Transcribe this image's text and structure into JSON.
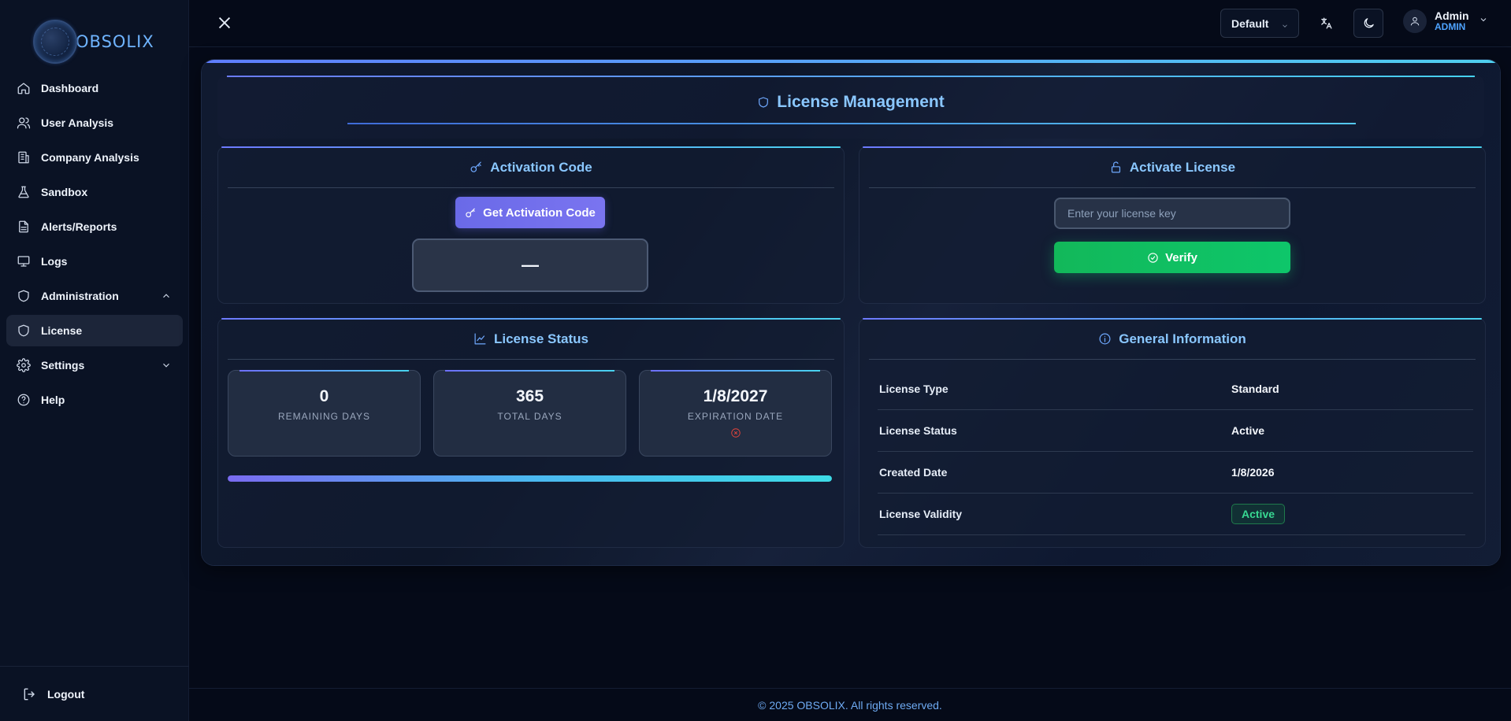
{
  "app": {
    "name": "OBSOLIX"
  },
  "sidebar": {
    "items": [
      {
        "label": "Dashboard",
        "icon": "home-icon"
      },
      {
        "label": "User Analysis",
        "icon": "users-icon"
      },
      {
        "label": "Company Analysis",
        "icon": "building-icon"
      },
      {
        "label": "Sandbox",
        "icon": "flask-icon"
      },
      {
        "label": "Alerts/Reports",
        "icon": "document-icon"
      },
      {
        "label": "Logs",
        "icon": "monitor-icon"
      },
      {
        "label": "Administration",
        "icon": "shield-icon"
      },
      {
        "label": "License",
        "icon": "shield-icon"
      },
      {
        "label": "Settings",
        "icon": "gear-icon"
      },
      {
        "label": "Help",
        "icon": "help-icon"
      }
    ],
    "logout_label": "Logout"
  },
  "topbar": {
    "theme_value": "Default",
    "user_name": "Admin",
    "user_role": "ADMIN"
  },
  "page": {
    "title": "License Management",
    "activation_code": {
      "heading": "Activation Code",
      "button_label": "Get Activation Code",
      "code_value": "—"
    },
    "activate_license": {
      "heading": "Activate License",
      "input_placeholder": "Enter your license key",
      "input_value": "",
      "verify_label": "Verify"
    },
    "license_status": {
      "heading": "License Status",
      "stats": [
        {
          "value": "0",
          "label": "REMAINING DAYS"
        },
        {
          "value": "365",
          "label": "TOTAL DAYS"
        },
        {
          "value": "1/8/2027",
          "label": "EXPIRATION DATE"
        }
      ],
      "progress": 1.0
    },
    "general_info": {
      "heading": "General Information",
      "rows": [
        {
          "key": "License Type",
          "value": "Standard"
        },
        {
          "key": "License Status",
          "value": "Active"
        },
        {
          "key": "Created Date",
          "value": "1/8/2026"
        },
        {
          "key": "License Validity",
          "value": "Active"
        }
      ]
    }
  },
  "footer": {
    "text": "© 2025 OBSOLIX. All rights reserved."
  },
  "colors": {
    "accent": "#8ac7ff",
    "verify": "#12b85a",
    "activation_button": "#6a6ae8",
    "badge_text": "#38d992",
    "background": "#050a18"
  }
}
